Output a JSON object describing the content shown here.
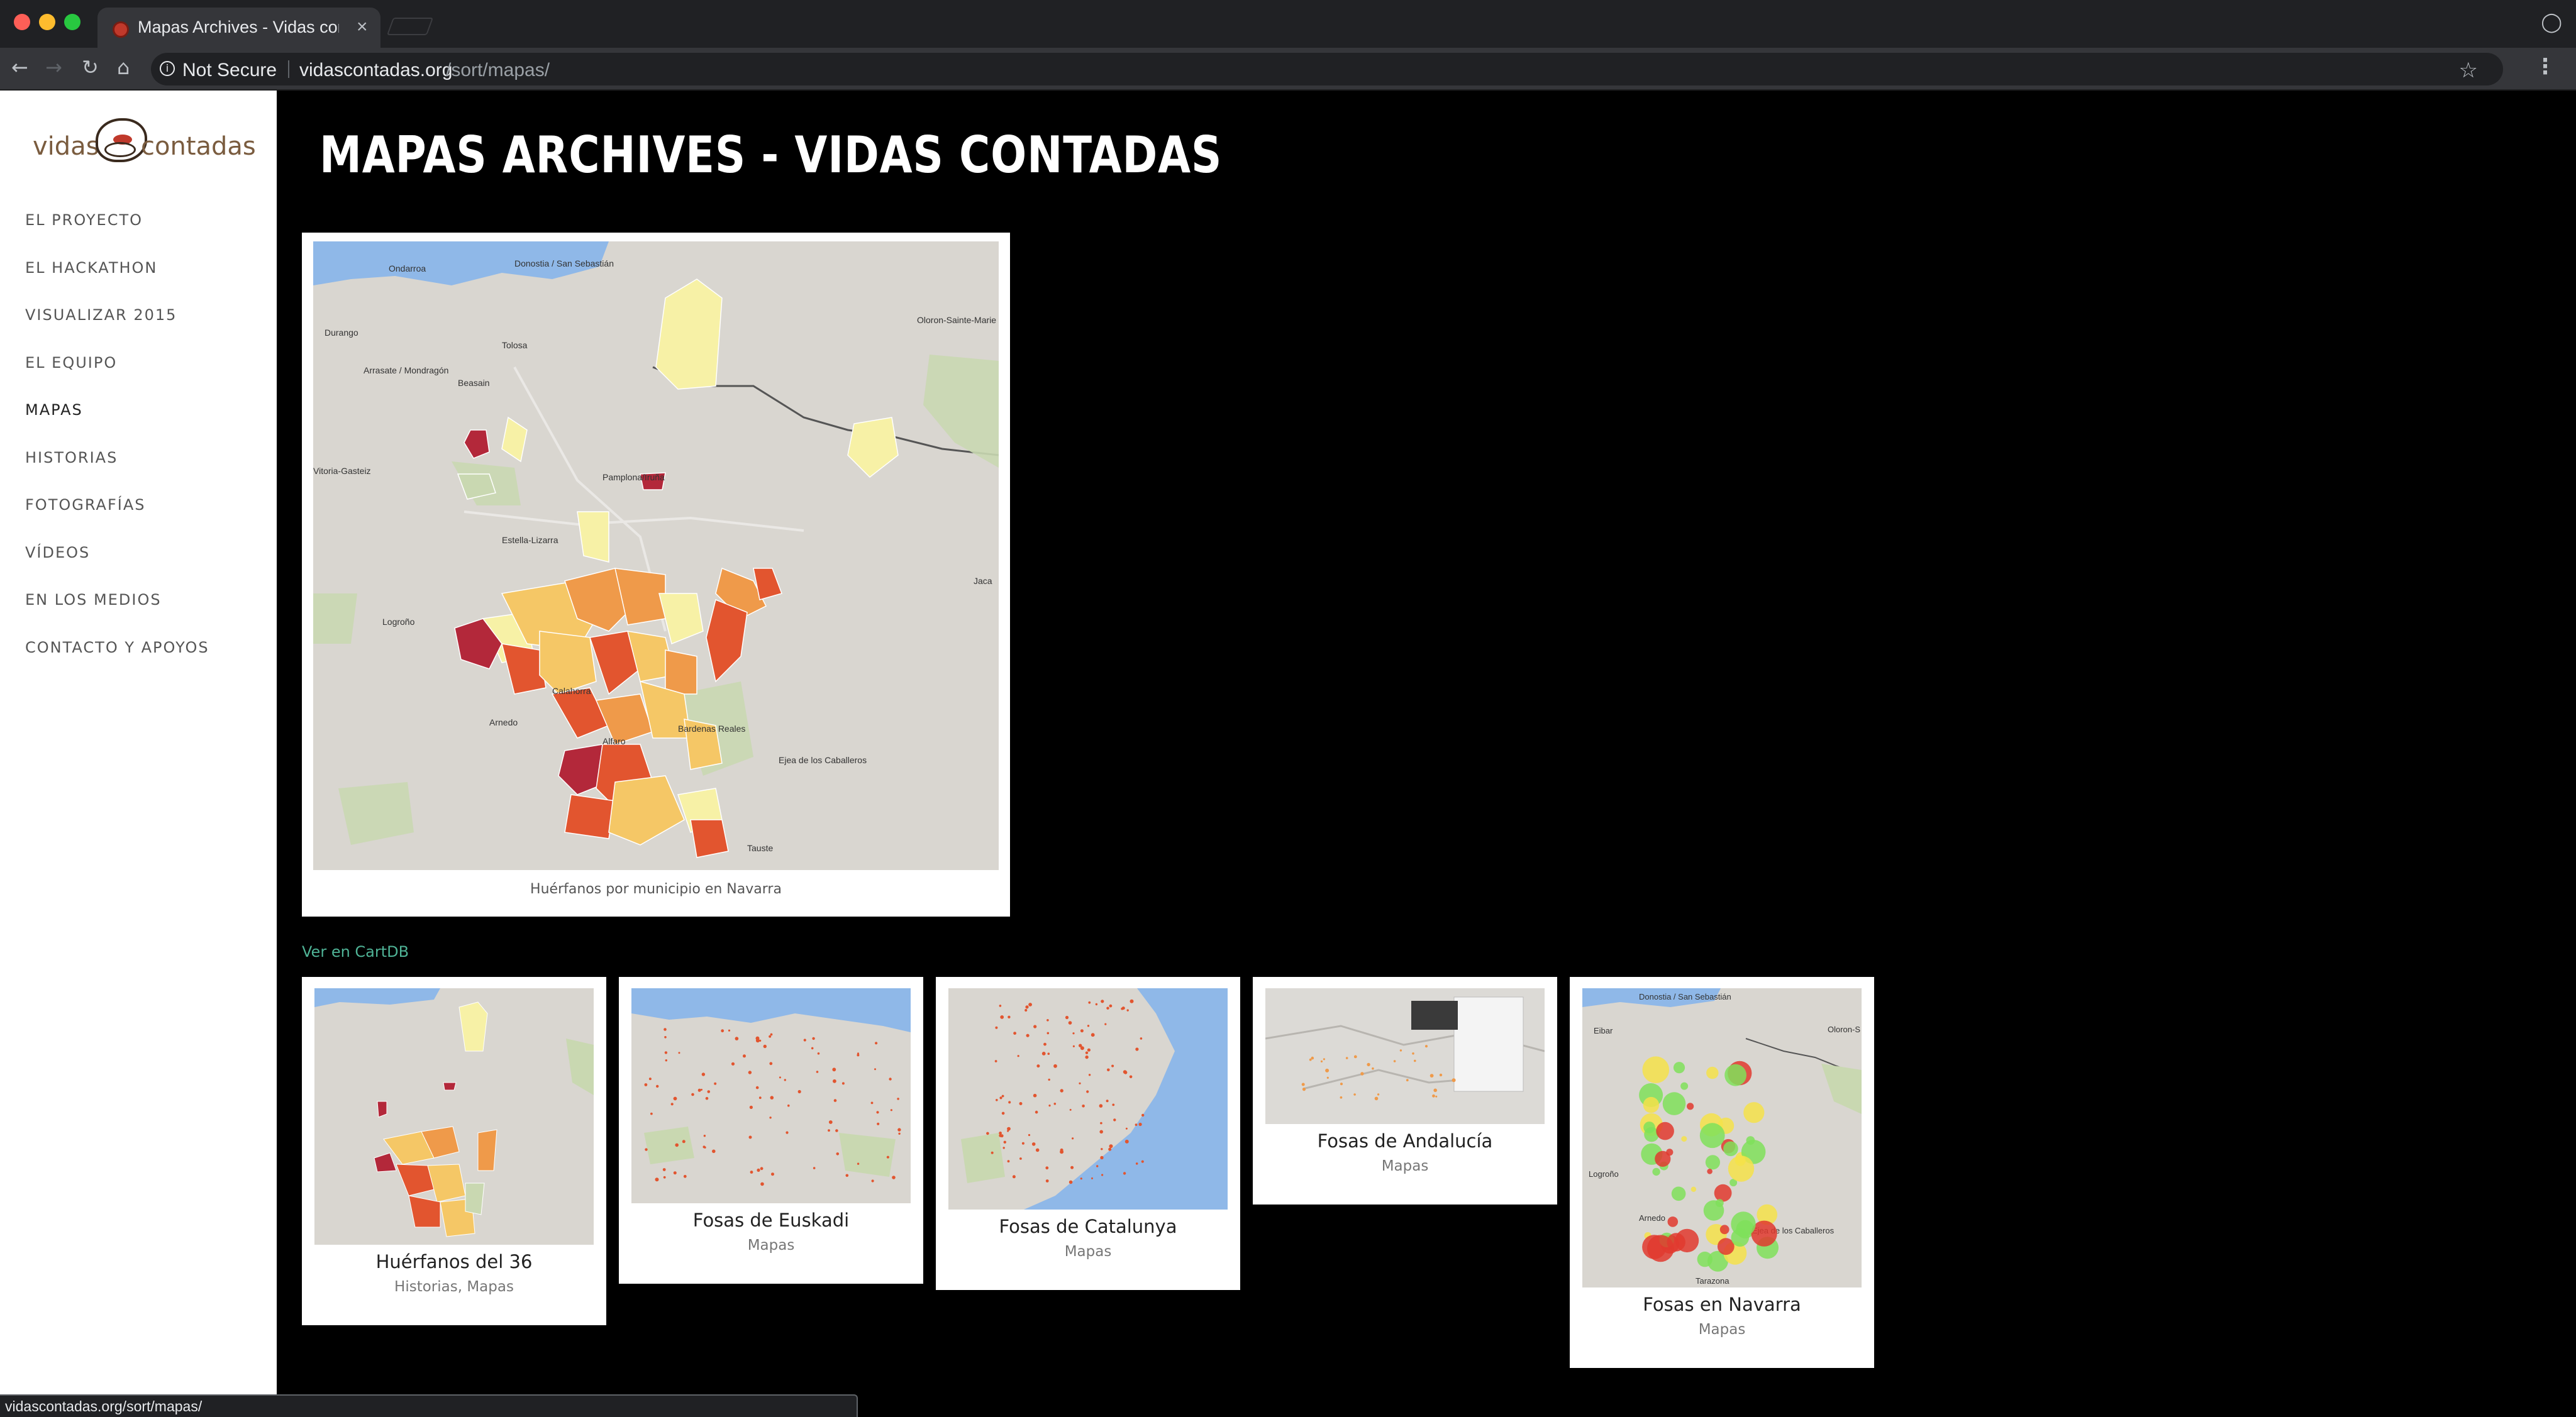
{
  "browser": {
    "tab_title": "Mapas Archives - Vidas contadas",
    "tab_close": "×",
    "security_label": "Not Secure",
    "url_host": "vidascontadas.org",
    "url_path": "/sort/mapas/",
    "status_url": "vidascontadas.org/sort/mapas/"
  },
  "site": {
    "logo_left": "vidas",
    "logo_right": "contadas",
    "nav": [
      "EL PROYECTO",
      "EL HACKATHON",
      "VISUALIZAR 2015",
      "EL EQUIPO",
      "MAPAS",
      "HISTORIAS",
      "FOTOGRAFÍAS",
      "VÍDEOS",
      "EN LOS MEDIOS",
      "CONTACTO Y APOYOS"
    ],
    "active_nav": "MAPAS"
  },
  "page": {
    "title": "MAPAS ARCHIVES - VIDAS CONTADAS",
    "hero_caption": "Huérfanos por municipio en Navarra",
    "cartodb_link": "Ver en CartDB",
    "hero_map_labels": [
      "Donostia / San Sebastián",
      "Oloron-Sainte-Marie",
      "Ondarroa",
      "Durango",
      "Tolosa",
      "Arrasate / Mondragón",
      "Beasain",
      "Vitoria-Gasteiz",
      "Pamplona/Iruña",
      "Estella-Lizarra",
      "Logroño",
      "Calahorra",
      "Arnedo",
      "Alfaro",
      "Ejea de los Caballeros",
      "Tauste",
      "Jaca",
      "Bardenas Reales"
    ]
  },
  "cards": [
    {
      "title": "Huérfanos del 36",
      "categories": "Historias, Mapas"
    },
    {
      "title": "Fosas de Euskadi",
      "categories": "Mapas"
    },
    {
      "title": "Fosas de Catalunya",
      "categories": "Mapas"
    },
    {
      "title": "Fosas de Andalucía",
      "categories": "Mapas"
    },
    {
      "title": "Fosas en Navarra",
      "categories": "Mapas",
      "map_labels": [
        "Donostia / San Sebastián",
        "Oloron-S",
        "Eibar",
        "Logroño",
        "Arnedo",
        "Ejea de los Caballeros",
        "Tarazona"
      ]
    }
  ],
  "colors": {
    "sidebar_bg": "#ffffff",
    "page_bg": "#000000",
    "link": "#4fb396",
    "logo": "#7a5c3f",
    "choropleth": [
      "#f7f1a6",
      "#f5c766",
      "#ef9a4a",
      "#e2552f",
      "#b3283a"
    ],
    "dot_green": "#7fe05a",
    "dot_red": "#e03a2f",
    "sea": "#8fb8e8",
    "land": "#d9d6d0"
  },
  "icons": [
    "back-arrow-icon",
    "forward-arrow-icon",
    "reload-icon",
    "home-icon",
    "info-icon",
    "star-icon",
    "menu-icon",
    "profile-icon"
  ]
}
